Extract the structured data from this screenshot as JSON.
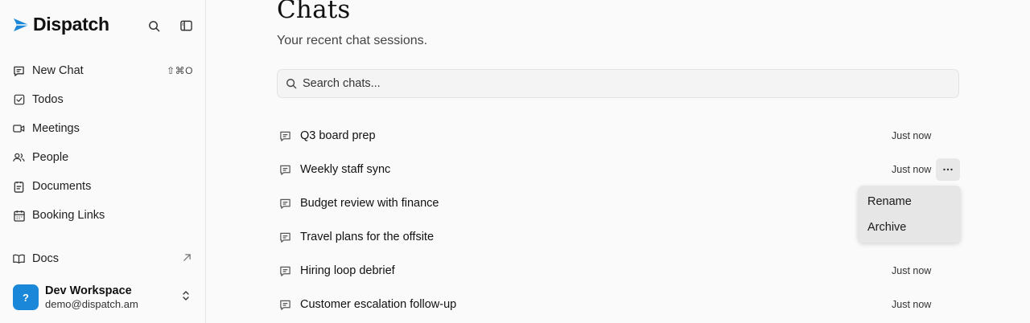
{
  "app": {
    "name": "Dispatch",
    "accent": "#1a87d8"
  },
  "sidebar": {
    "items": [
      {
        "label": "New Chat",
        "icon": "chat-bubble-icon",
        "shortcut": "⇧⌘O"
      },
      {
        "label": "Todos",
        "icon": "checkbox-icon"
      },
      {
        "label": "Meetings",
        "icon": "video-icon"
      },
      {
        "label": "People",
        "icon": "people-icon"
      },
      {
        "label": "Documents",
        "icon": "document-icon"
      },
      {
        "label": "Booking Links",
        "icon": "calendar-icon"
      }
    ],
    "docs": {
      "label": "Docs",
      "icon": "book-icon"
    },
    "workspace": {
      "avatar": "?",
      "name": "Dev Workspace",
      "email": "demo@dispatch.am"
    }
  },
  "main": {
    "title": "Chats",
    "subtitle": "Your recent chat sessions.",
    "search": {
      "placeholder": "Search chats..."
    },
    "chats": [
      {
        "title": "Q3 board prep",
        "time": "Just now"
      },
      {
        "title": "Weekly staff sync",
        "time": "Just now"
      },
      {
        "title": "Budget review with finance",
        "time": ""
      },
      {
        "title": "Travel plans for the offsite",
        "time": ""
      },
      {
        "title": "Hiring loop debrief",
        "time": "Just now"
      },
      {
        "title": "Customer escalation follow-up",
        "time": "Just now"
      }
    ]
  },
  "context_menu": {
    "items": [
      "Rename",
      "Archive"
    ]
  }
}
